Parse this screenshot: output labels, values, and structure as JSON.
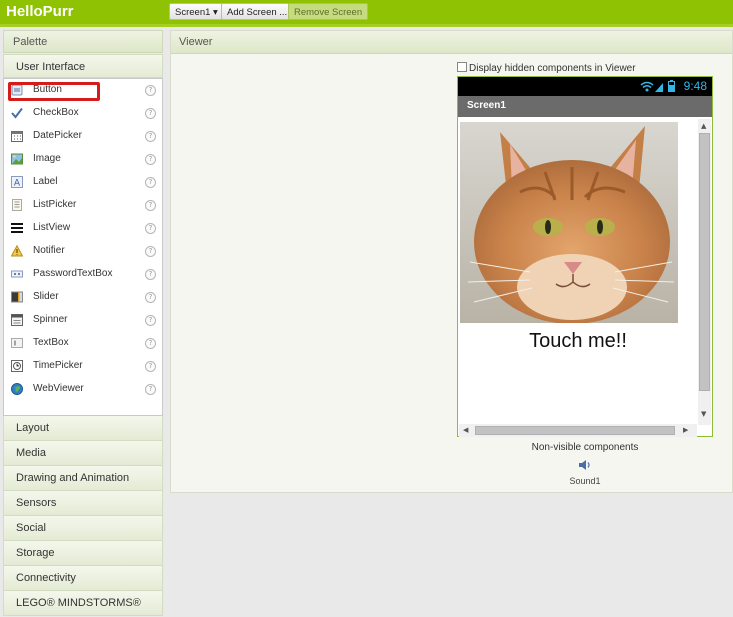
{
  "app": {
    "title": "HelloPurr"
  },
  "toolbar": {
    "screen_dropdown": "Screen1 ▾",
    "add_screen": "Add Screen ...",
    "remove_screen": "Remove Screen"
  },
  "palette": {
    "header": "Palette",
    "open_category": "User Interface",
    "components": [
      {
        "label": "Button",
        "icon": "button-icon"
      },
      {
        "label": "CheckBox",
        "icon": "checkbox-icon"
      },
      {
        "label": "DatePicker",
        "icon": "datepicker-icon"
      },
      {
        "label": "Image",
        "icon": "image-icon"
      },
      {
        "label": "Label",
        "icon": "label-icon"
      },
      {
        "label": "ListPicker",
        "icon": "listpicker-icon"
      },
      {
        "label": "ListView",
        "icon": "listview-icon"
      },
      {
        "label": "Notifier",
        "icon": "notifier-icon"
      },
      {
        "label": "PasswordTextBox",
        "icon": "passwordtextbox-icon"
      },
      {
        "label": "Slider",
        "icon": "slider-icon"
      },
      {
        "label": "Spinner",
        "icon": "spinner-icon"
      },
      {
        "label": "TextBox",
        "icon": "textbox-icon"
      },
      {
        "label": "TimePicker",
        "icon": "timepicker-icon"
      },
      {
        "label": "WebViewer",
        "icon": "webviewer-icon"
      }
    ],
    "help_glyph": "?",
    "categories": [
      "Layout",
      "Media",
      "Drawing and Animation",
      "Sensors",
      "Social",
      "Storage",
      "Connectivity",
      "LEGO® MINDSTORMS®"
    ]
  },
  "viewer": {
    "header": "Viewer",
    "display_hidden_label": "Display hidden components in Viewer",
    "phone": {
      "time": "9:48",
      "screen_title": "Screen1",
      "button_text": "Touch me!!"
    },
    "nonvisible_label": "Non-visible components",
    "sound_label": "Sound1"
  },
  "colors": {
    "topbar": "#8fc202",
    "highlight": "#d61b1b",
    "time": "#33b5e5"
  }
}
